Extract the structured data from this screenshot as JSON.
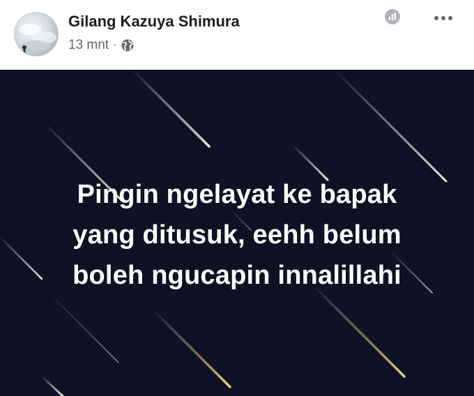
{
  "post": {
    "author": "Gilang Kazuya Shimura",
    "time": "13 mnt",
    "separator": "·",
    "privacy_icon": "globe-icon",
    "header_icons": [
      "insights-icon",
      "more-options-icon"
    ],
    "colors": {
      "image_background": "#0f1125",
      "text": "#ffffff",
      "meta_text": "#65676b"
    },
    "text_lines": [
      "Pingin ngelayat ke bapak",
      "yang ditusuk, eehh belum",
      "boleh ngucapin innalillahi"
    ]
  }
}
